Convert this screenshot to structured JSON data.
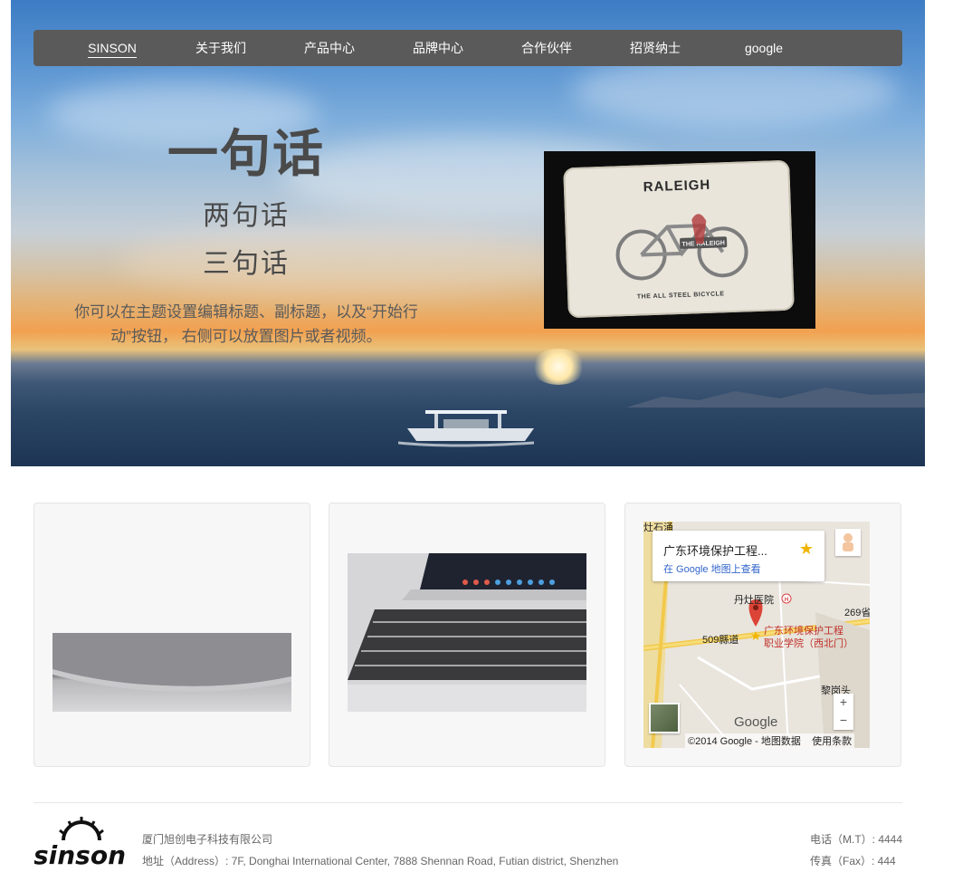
{
  "nav": {
    "items": [
      {
        "label": "SINSON",
        "active": true
      },
      {
        "label": "关于我们"
      },
      {
        "label": "产品中心"
      },
      {
        "label": "品牌中心"
      },
      {
        "label": "合作伙伴"
      },
      {
        "label": "招贤纳士"
      },
      {
        "label": "google"
      }
    ]
  },
  "hero": {
    "title": "一句话",
    "subtitle1": "两句话",
    "subtitle2": "三句话",
    "description": "你可以在主题设置编辑标题、副标题，以及“开始行动”按钮， 右侧可以放置图片或者视频。",
    "image": {
      "brand": "RALEIGH",
      "caption": "THE ALL STEEL BICYCLE",
      "badge": "THE RALEIGH"
    }
  },
  "map": {
    "popup_title": "广东环境保护工程...",
    "popup_link": "在 Google 地图上查看",
    "labels": {
      "top": "灶石涌",
      "hospital": "丹灶医院",
      "road": "509縣道",
      "road2": "269省",
      "place_line1": "广东环境保护工程",
      "place_line2": "职业学院（西北门）",
      "village": "黎岗头"
    },
    "zoom_in": "+",
    "zoom_out": "−",
    "logo_text": "Google",
    "attribution": "©2014 Google - 地图数据",
    "terms": "使用条款"
  },
  "footer": {
    "logo_text": "sinson",
    "company": "厦门旭创电子科技有限公司",
    "address": "地址（Address）: 7F, Donghai International Center, 7888 Shennan Road, Futian district, Shenzhen",
    "phone": "电话（M.T）: 4444",
    "fax": "传真（Fax）: 444"
  }
}
